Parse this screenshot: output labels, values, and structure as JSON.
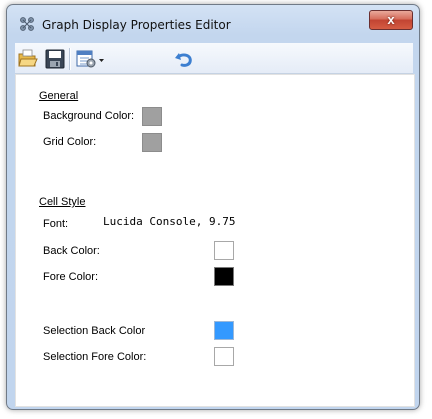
{
  "window": {
    "title": "Graph Display Properties Editor",
    "close_glyph": "x"
  },
  "toolbar": {
    "items": [
      {
        "name": "open-icon"
      },
      {
        "name": "save-icon"
      },
      {
        "name": "properties-dropdown-icon"
      },
      {
        "name": "undo-icon"
      }
    ]
  },
  "general": {
    "heading": "General",
    "background_color_label": "Background Color:",
    "background_color": "#a0a0a0",
    "grid_color_label": "Grid Color:",
    "grid_color": "#a0a0a0"
  },
  "cell_style": {
    "heading": "Cell Style",
    "font_label": "Font:",
    "font_value": "Lucida Console, 9.75",
    "back_color_label": "Back Color:",
    "back_color": "#ffffff",
    "fore_color_label": "Fore Color:",
    "fore_color": "#000000",
    "selection_back_label": "Selection Back Color",
    "selection_back_color": "#3399ff",
    "selection_fore_label": "Selection Fore Color:",
    "selection_fore_color": "#ffffff"
  }
}
